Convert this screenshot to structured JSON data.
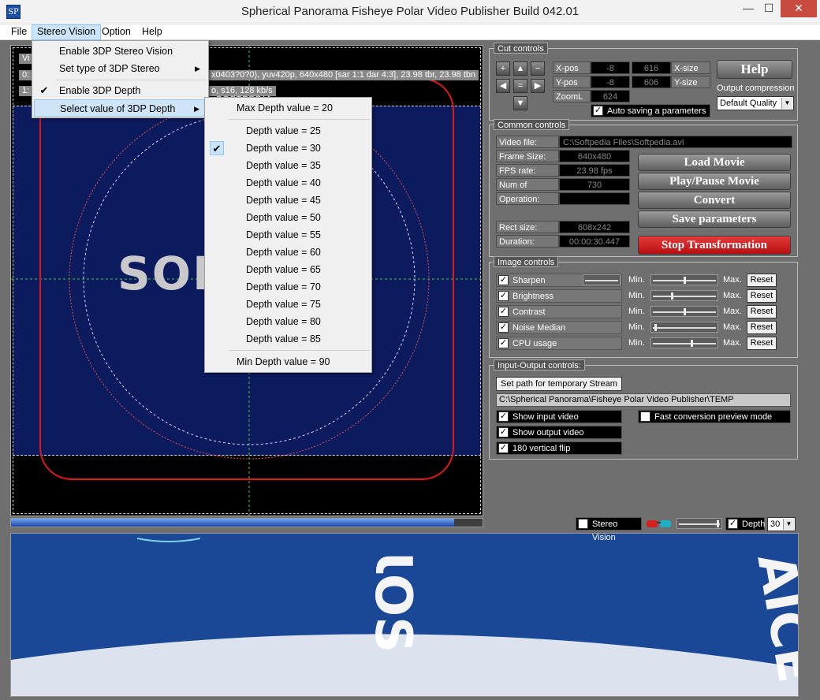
{
  "app": {
    "icon_text": "SP",
    "title": "Spherical Panorama Fisheye Polar Video Publisher  Build 042.01",
    "min": "—",
    "max": "☐",
    "close": "✕"
  },
  "menubar": {
    "file": "File",
    "stereo": "Stereo Vision",
    "option": "Option",
    "help": "Help"
  },
  "stereo_menu": {
    "enable_3dp_stereo": "Enable 3DP Stereo Vision",
    "set_type": "Set type of 3DP Stereo",
    "enable_depth": "Enable 3DP Depth",
    "select_depth": "Select value of 3DP Depth"
  },
  "depth_menu": {
    "max": "Max Depth value = 20",
    "items": [
      "Depth value = 25",
      "Depth value = 30",
      "Depth value = 35",
      "Depth value = 40",
      "Depth value = 45",
      "Depth value = 50",
      "Depth value = 55",
      "Depth value = 60",
      "Depth value = 65",
      "Depth value = 70",
      "Depth value = 75",
      "Depth value = 80",
      "Depth value = 85"
    ],
    "min": "Min Depth value = 90",
    "checked": "Depth value = 30"
  },
  "video_overlay": {
    "line0": "Vi",
    "line1_prefix": "0:",
    "line1": "x0403?0?0), yuv420p, 640x480 [sar 1:1 dar 4:3], 23.98 tbr, 23.98 tbn",
    "line2_prefix": "1:",
    "line2": "o, s16, 128 kb/s",
    "logo_text": "SOF",
    "watermark": "SOFTPEDIA"
  },
  "progress": {
    "value": 0.94
  },
  "cut_controls": {
    "title": "Cut controls",
    "xpos_label": "X-pos",
    "xpos1": "-8",
    "xpos2": "616",
    "xsize_label": "X-size",
    "ypos_label": "Y-pos",
    "ypos1": "-8",
    "ypos2": "606",
    "ysize_label": "Y-size",
    "zoom_label": "ZoomL",
    "zoom": "624",
    "auto_save": "Auto saving a parameters",
    "help": "Help",
    "output_compression": "Output compression",
    "quality": "Default Quality"
  },
  "common_controls": {
    "title": "Common controls",
    "video_file_label": "Video file:",
    "video_file": "C:\\Softpedia Files\\Softpedia.avi",
    "frame_size_label": "Frame Size:",
    "frame_size": "640x480",
    "fps_label": "FPS rate:",
    "fps": "23.98 fps",
    "frames_label": "Num of frames:",
    "frames": "730",
    "operation_label": "Operation:",
    "operation": "",
    "rect_label": "Rect size:",
    "rect": "608x242",
    "duration_label": "Duration:",
    "duration": "00:00:30.447",
    "load": "Load Movie",
    "play": "Play/Pause Movie",
    "convert": "Convert",
    "save": "Save parameters",
    "stop": "Stop Transformation"
  },
  "image_controls": {
    "title": "Image controls",
    "min": "Min.",
    "max": "Max.",
    "reset": "Reset",
    "rows": [
      {
        "label": "Sharpen",
        "level": 0.5
      },
      {
        "label": "Brightness",
        "level": 0.3
      },
      {
        "label": "Contrast",
        "level": 0.5
      },
      {
        "label": "Noise Median",
        "level": 0.02
      },
      {
        "label": "CPU usage",
        "level": 0.62
      }
    ]
  },
  "io_controls": {
    "title": "Input-Output controls:",
    "set_path": "Set path for temporary Stream",
    "path": "C:\\Spherical Panorama\\Fisheye Polar Video Publisher\\TEMP",
    "show_input": "Show input video",
    "show_output": "Show output video",
    "vflip": "180 vertical flip",
    "fast_preview": "Fast conversion preview mode"
  },
  "bottom_bar": {
    "stereo": "Stereo Vision",
    "depth": "Depth",
    "depth_value": "30"
  },
  "output_text": {
    "a": "ƖOS",
    "b": "AICE"
  },
  "colors": {
    "accent_red": "#d11a1a",
    "video_bg": "#0c1a5e",
    "output_bg": "#1a4796"
  }
}
